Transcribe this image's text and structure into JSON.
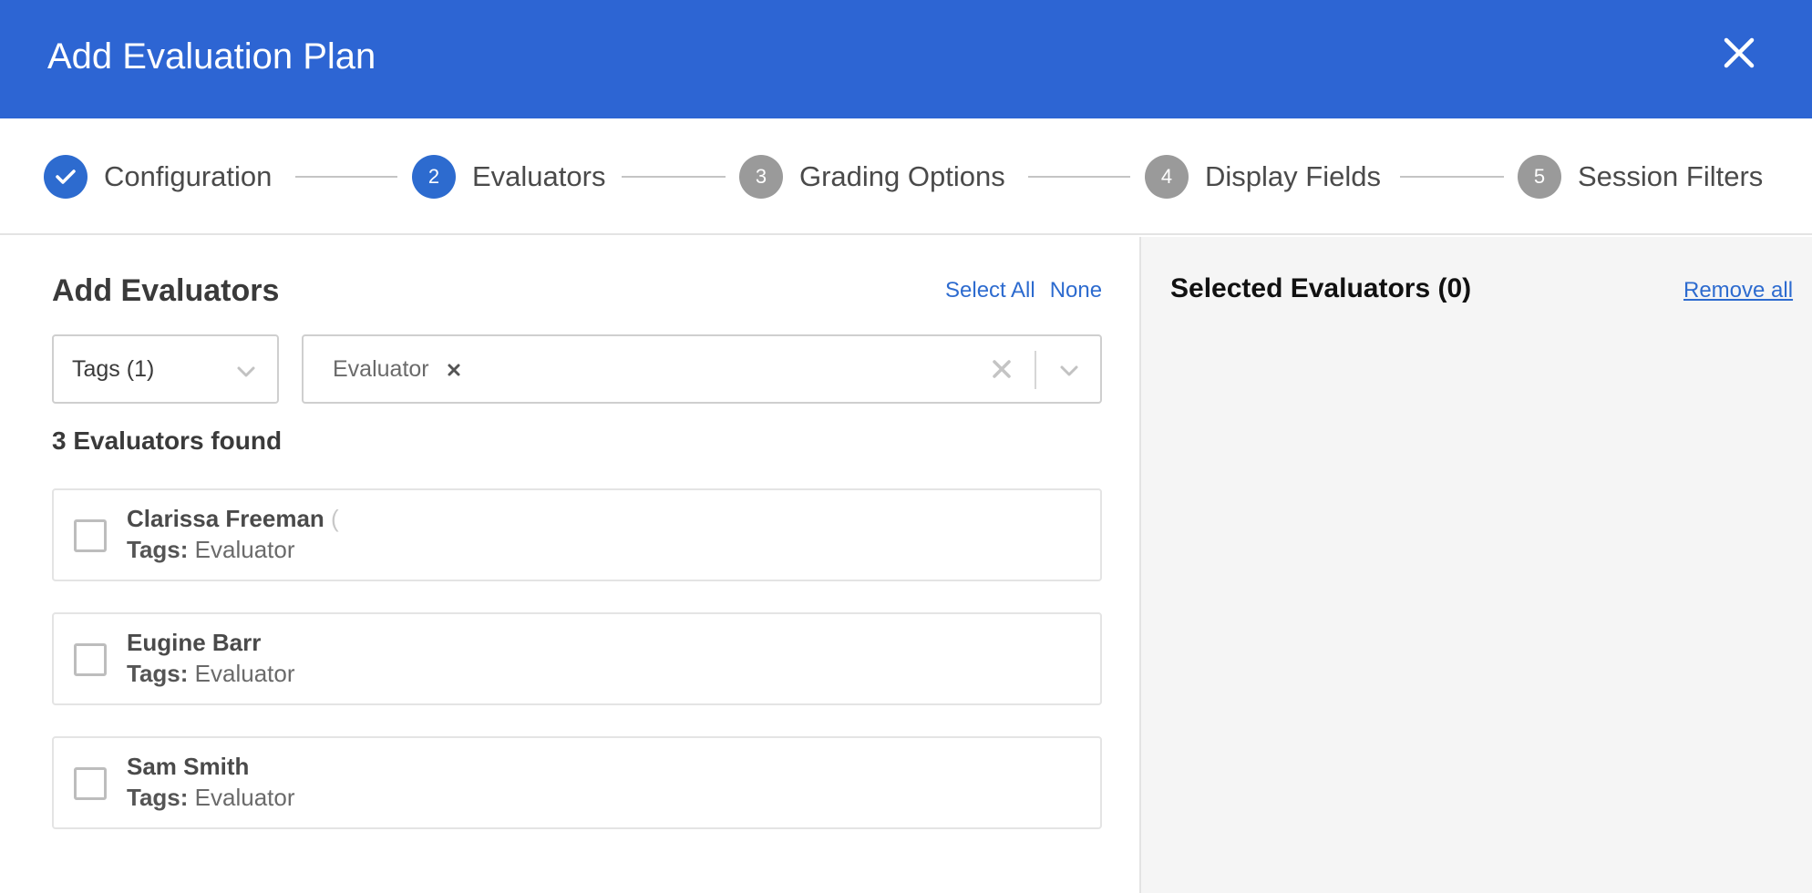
{
  "modal": {
    "title": "Add Evaluation Plan"
  },
  "stepper": {
    "steps": [
      {
        "number": "",
        "label": "Configuration",
        "state": "done"
      },
      {
        "number": "2",
        "label": "Evaluators",
        "state": "active"
      },
      {
        "number": "3",
        "label": "Grading Options",
        "state": "pending"
      },
      {
        "number": "4",
        "label": "Display Fields",
        "state": "pending"
      },
      {
        "number": "5",
        "label": "Session Filters",
        "state": "pending"
      }
    ]
  },
  "add_panel": {
    "title": "Add Evaluators",
    "select_all_label": "Select All",
    "none_label": "None",
    "tags_select_value": "Tags (1)",
    "chip_label": "Evaluator",
    "result_count_text": "3 Evaluators found",
    "evaluators": [
      {
        "name": "Clarissa Freeman",
        "name_suffix": "(",
        "tags_label": "Tags:",
        "tags": "Evaluator"
      },
      {
        "name": "Eugine Barr",
        "name_suffix": "",
        "tags_label": "Tags:",
        "tags": "Evaluator"
      },
      {
        "name": "Sam Smith",
        "name_suffix": "",
        "tags_label": "Tags:",
        "tags": "Evaluator"
      }
    ]
  },
  "selected_panel": {
    "title": "Selected Evaluators (0)",
    "remove_all_label": "Remove all"
  },
  "colors": {
    "header_bg": "#2d65d3",
    "accent": "#2d6bcf",
    "pending_step": "#9a9a9a"
  }
}
